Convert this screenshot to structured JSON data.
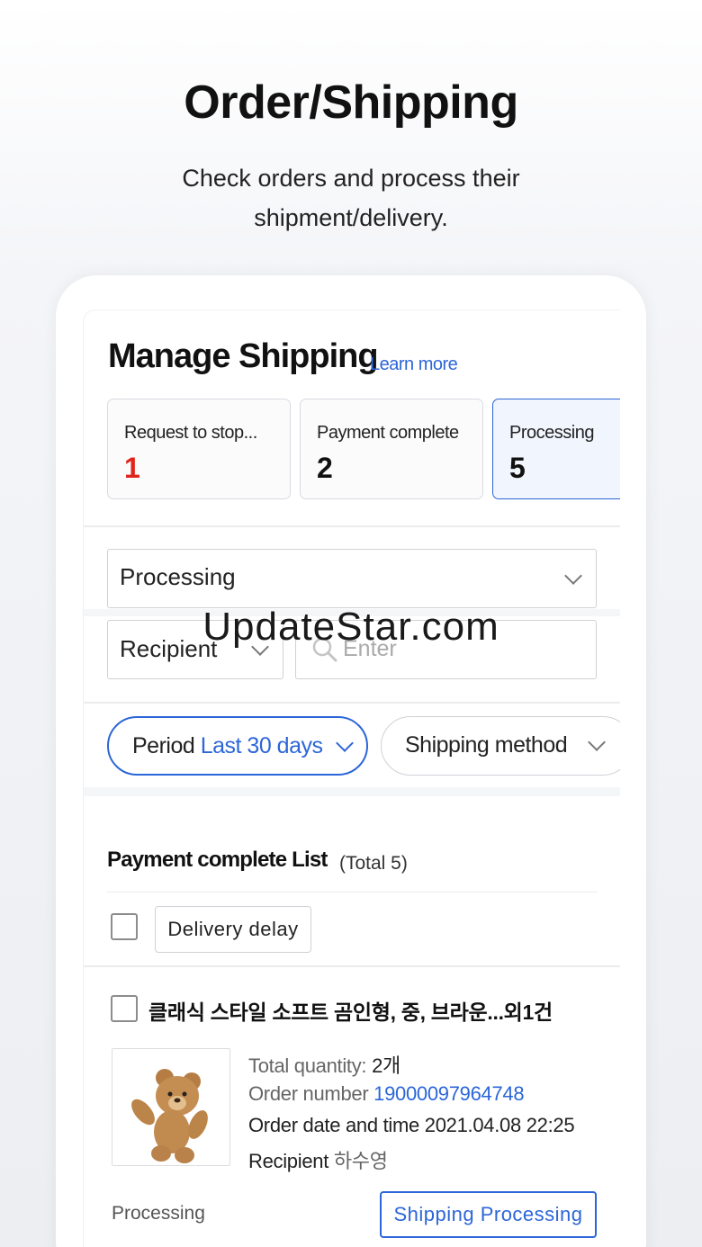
{
  "hero": {
    "title": "Order/Shipping",
    "subtitle": "Check orders and process their shipment/delivery."
  },
  "manage": {
    "title": "Manage Shipping",
    "learn_more": "Learn more"
  },
  "status_cards": [
    {
      "label": "Request to stop...",
      "count": "1"
    },
    {
      "label": "Payment complete",
      "count": "2"
    },
    {
      "label": "Processing",
      "count": "5"
    }
  ],
  "filters": {
    "status_select": "Processing",
    "search_field_select": "Recipient",
    "search_placeholder": "Enter",
    "period_label": "Period",
    "period_value": "Last 30 days",
    "shipping_method": "Shipping method"
  },
  "watermark": "UpdateStar.com",
  "list": {
    "title": "Payment complete List",
    "total": "(Total 5)",
    "delivery_delay_button": "Delivery delay"
  },
  "order": {
    "title": "클래식 스타일 소프트 곰인형, 중, 브라운...외1건",
    "quantity_label": "Total quantity:",
    "quantity_value": "2개",
    "order_number_label": "Order number",
    "order_number_value": "19000097964748",
    "order_date_label": "Order date and time",
    "order_date_value": "2021.04.08 22:25",
    "recipient_label": "Recipient",
    "recipient_value": "하수영",
    "status": "Processing",
    "action_button": "Shipping Processing"
  },
  "colors": {
    "accent": "#2c66d8",
    "alert_red": "#e0261c"
  }
}
